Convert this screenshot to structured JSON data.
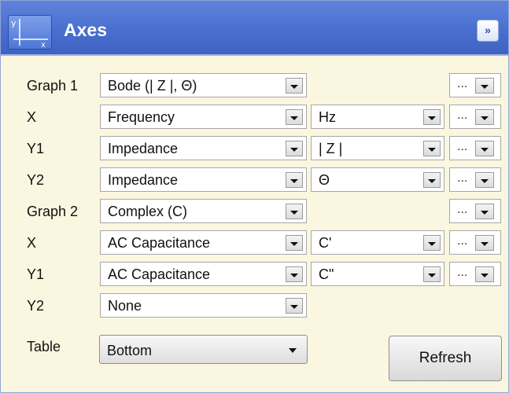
{
  "header": {
    "title": "Axes",
    "icon": "axes-icon",
    "collapse_icon": "double-chevron-up-icon"
  },
  "rows": [
    {
      "label": "Graph 1",
      "select": "Bode (| Z |, Θ)",
      "unit": null
    },
    {
      "label": "X",
      "select": "Frequency",
      "unit": "Hz"
    },
    {
      "label": "Y1",
      "select": "Impedance",
      "unit": "| Z |"
    },
    {
      "label": "Y2",
      "select": "Impedance",
      "unit": "Θ"
    },
    {
      "label": "Graph 2",
      "select": "Complex (C)",
      "unit": null
    },
    {
      "label": "X",
      "select": "AC Capacitance",
      "unit": "C'"
    },
    {
      "label": "Y1",
      "select": "AC Capacitance",
      "unit": "C\""
    },
    {
      "label": "Y2",
      "select": "None",
      "unit": null
    }
  ],
  "more_label": "...",
  "table": {
    "label": "Table",
    "value": "Bottom"
  },
  "refresh_label": "Refresh",
  "colors": {
    "header": "#4a6fcf",
    "panel_bg": "#fbf6e0",
    "border": "#8fa6d6"
  }
}
